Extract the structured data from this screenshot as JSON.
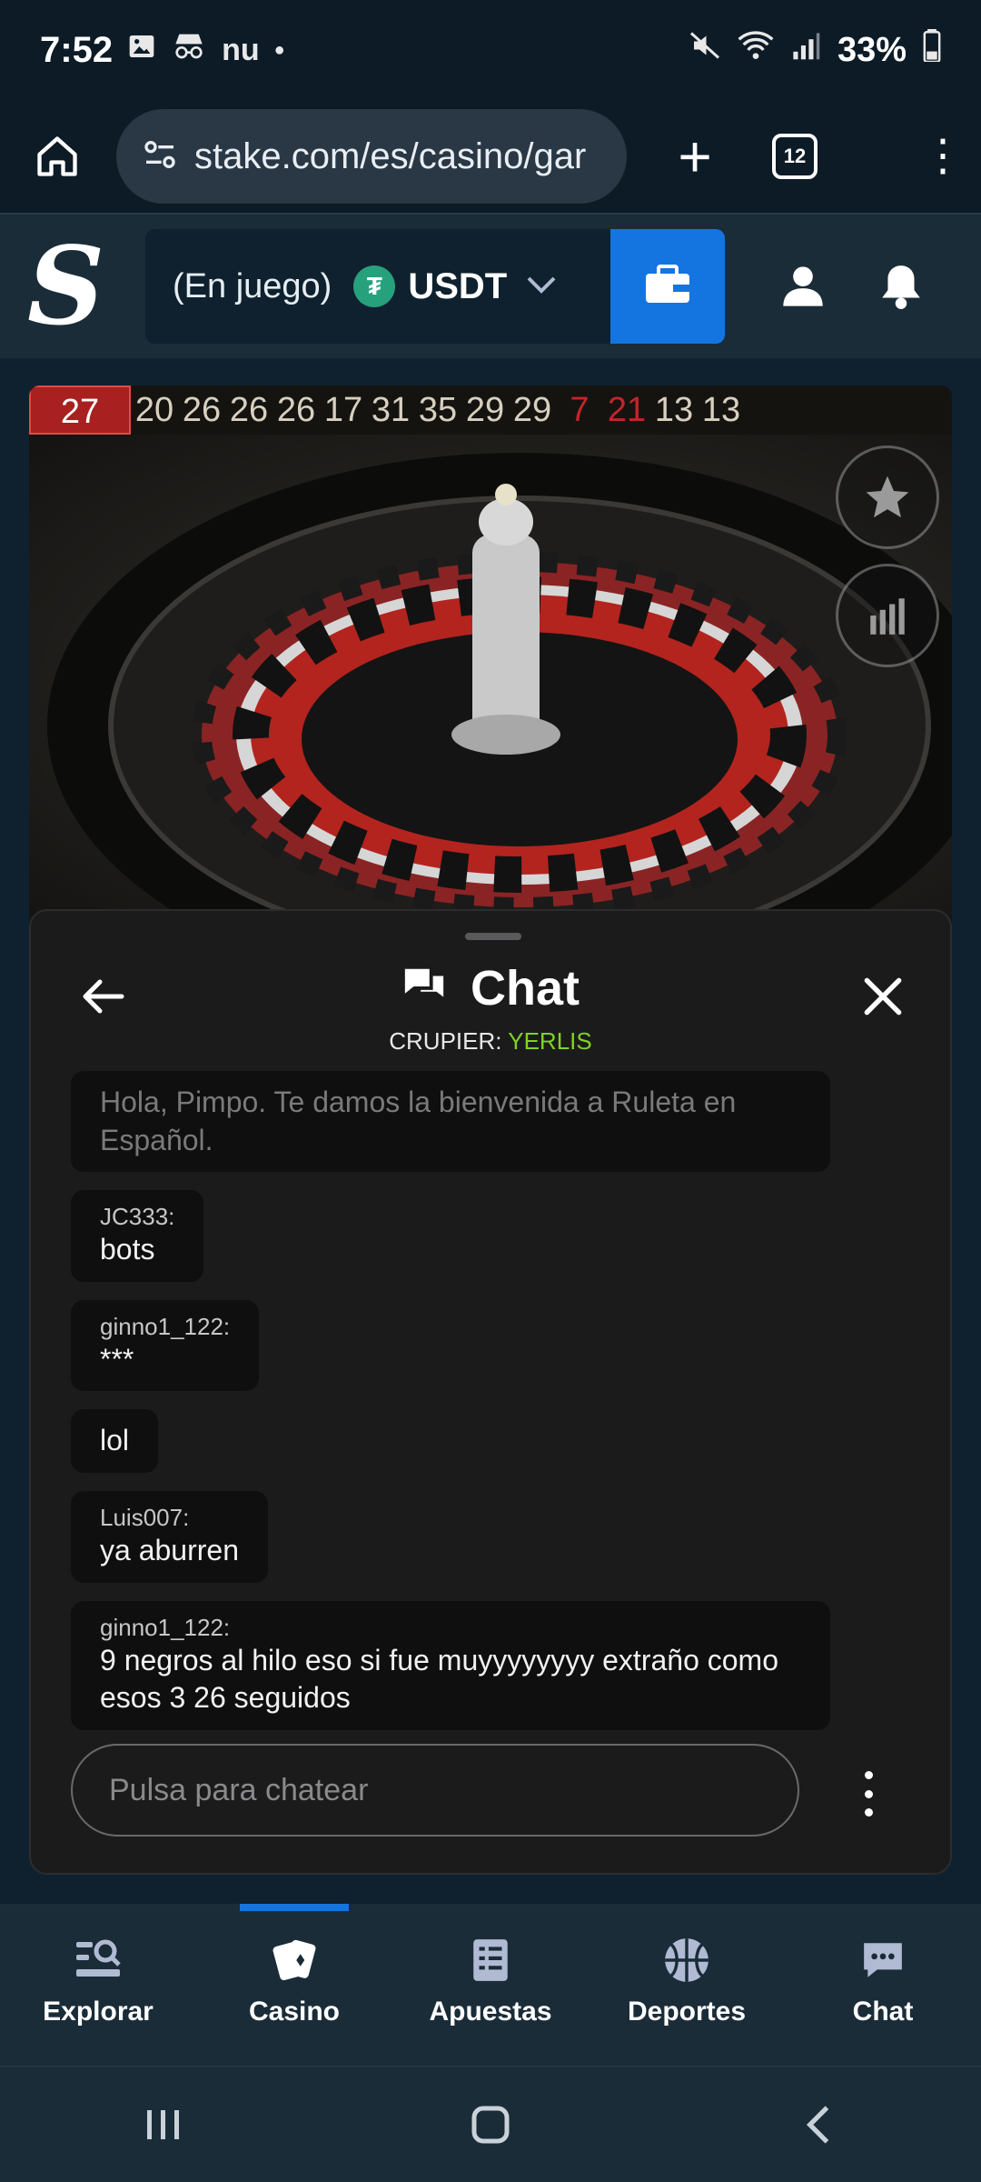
{
  "status_bar": {
    "time": "7:52",
    "carrier": "nu",
    "battery": "33%"
  },
  "browser": {
    "url": "stake.com/es/casino/gar",
    "tab_count": "12"
  },
  "header": {
    "wallet_status": "(En juego)",
    "currency": "USDT",
    "currency_icon": "tether-icon",
    "accent_color": "#1475e1"
  },
  "game": {
    "results": [
      {
        "value": "27",
        "color": "red"
      },
      {
        "value": "20",
        "color": "black"
      },
      {
        "value": "26",
        "color": "black"
      },
      {
        "value": "26",
        "color": "black"
      },
      {
        "value": "26",
        "color": "black"
      },
      {
        "value": "17",
        "color": "black"
      },
      {
        "value": "31",
        "color": "black"
      },
      {
        "value": "35",
        "color": "black"
      },
      {
        "value": "29",
        "color": "black"
      },
      {
        "value": "29",
        "color": "black"
      },
      {
        "value": "7",
        "color": "red"
      },
      {
        "value": "21",
        "color": "red"
      },
      {
        "value": "13",
        "color": "black"
      },
      {
        "value": "13",
        "color": "black"
      }
    ]
  },
  "chat": {
    "title": "Chat",
    "dealer_label": "CRUPIER:",
    "dealer_name": "YERLIS",
    "messages": [
      {
        "user": "",
        "text": "Hola, Pimpo. Te damos la bienvenida a Ruleta en Español."
      },
      {
        "user": "JC333:",
        "text": "bots"
      },
      {
        "user": "ginno1_122:",
        "text": "***"
      },
      {
        "user": "",
        "text": "lol"
      },
      {
        "user": "Luis007:",
        "text": "ya aburren"
      },
      {
        "user": "ginno1_122:",
        "text": "9 negros al hilo eso si fue muyyyyyyyy extraño como esos 3 26 seguidos"
      }
    ],
    "input_placeholder": "Pulsa para chatear"
  },
  "bottom_nav": {
    "items": [
      {
        "label": "Explorar",
        "icon": "explore-icon"
      },
      {
        "label": "Casino",
        "icon": "cards-icon"
      },
      {
        "label": "Apuestas",
        "icon": "betslip-icon"
      },
      {
        "label": "Deportes",
        "icon": "basketball-icon"
      },
      {
        "label": "Chat",
        "icon": "chat-icon"
      }
    ],
    "active": "Casino"
  }
}
